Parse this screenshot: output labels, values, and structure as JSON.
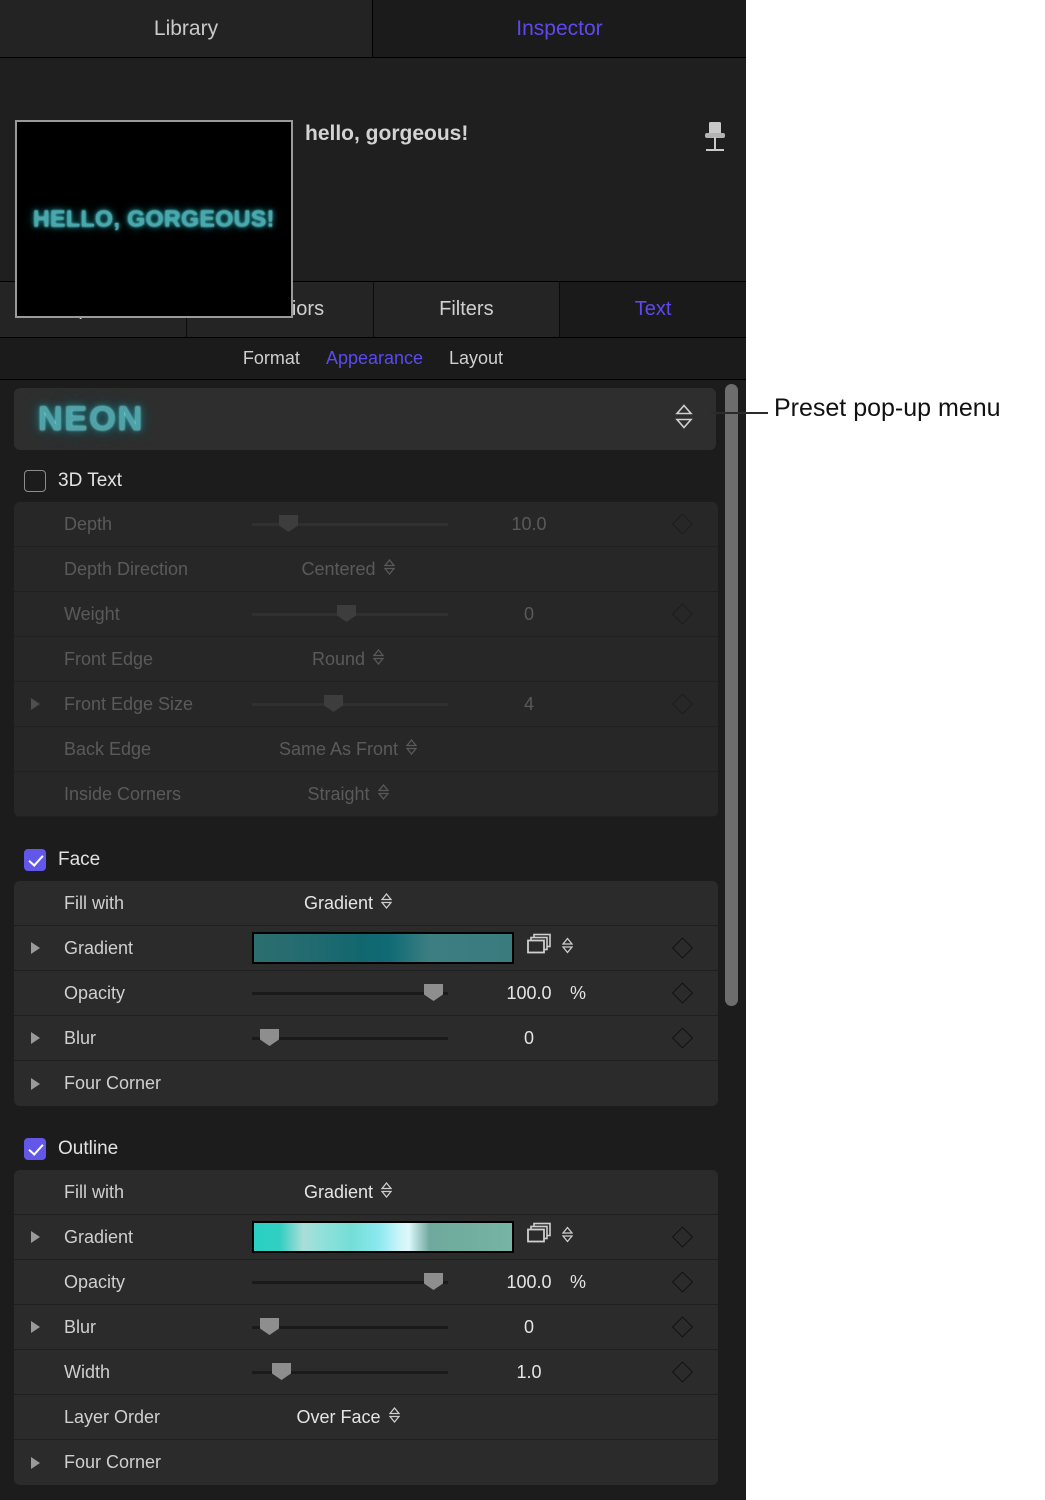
{
  "top_tabs": [
    {
      "label": "Library",
      "active": false
    },
    {
      "label": "Inspector",
      "active": true
    }
  ],
  "preview": {
    "object_title": "hello, gorgeous!",
    "thumbnail_text": "HELLO, GORGEOUS!",
    "pin_icon": "pin-icon"
  },
  "category_tabs": [
    {
      "label": "Properties",
      "active": false
    },
    {
      "label": "Behaviors",
      "active": false
    },
    {
      "label": "Filters",
      "active": false
    },
    {
      "label": "Text",
      "active": true
    }
  ],
  "sub_tabs": [
    {
      "label": "Format",
      "active": false
    },
    {
      "label": "Appearance",
      "active": true
    },
    {
      "label": "Layout",
      "active": false
    }
  ],
  "preset": {
    "name": "NEON",
    "stepper_icon": "stepper-updown-icon"
  },
  "sections": {
    "three_d_text": {
      "title": "3D Text",
      "checked": false,
      "enabled": false,
      "rows": [
        {
          "label": "Depth",
          "type": "slider",
          "value": "10.0",
          "unit": "",
          "knob": 0.17,
          "disclose": false,
          "keyframe": true
        },
        {
          "label": "Depth Direction",
          "type": "popup",
          "value": "Centered",
          "disclose": false,
          "keyframe": false
        },
        {
          "label": "Weight",
          "type": "slider",
          "value": "0",
          "unit": "",
          "knob": 0.48,
          "disclose": false,
          "keyframe": true
        },
        {
          "label": "Front Edge",
          "type": "popup",
          "value": "Round",
          "disclose": false,
          "keyframe": false
        },
        {
          "label": "Front Edge Size",
          "type": "slider",
          "value": "4",
          "unit": "",
          "knob": 0.41,
          "disclose": true,
          "keyframe": true
        },
        {
          "label": "Back Edge",
          "type": "popup",
          "value": "Same As Front",
          "disclose": false,
          "keyframe": false
        },
        {
          "label": "Inside Corners",
          "type": "popup",
          "value": "Straight",
          "disclose": false,
          "keyframe": false
        }
      ]
    },
    "face": {
      "title": "Face",
      "checked": true,
      "enabled": true,
      "rows": [
        {
          "label": "Fill with",
          "type": "popup",
          "value": "Gradient",
          "disclose": false,
          "keyframe": false
        },
        {
          "label": "Gradient",
          "type": "gradient",
          "gradient": "face",
          "disclose": true,
          "keyframe": true
        },
        {
          "label": "Opacity",
          "type": "slider",
          "value": "100.0",
          "unit": "%",
          "knob": 0.92,
          "disclose": false,
          "keyframe": true
        },
        {
          "label": "Blur",
          "type": "slider",
          "value": "0",
          "unit": "",
          "knob": 0.04,
          "disclose": true,
          "keyframe": true
        },
        {
          "label": "Four Corner",
          "type": "plain",
          "disclose": true,
          "keyframe": false
        }
      ]
    },
    "outline": {
      "title": "Outline",
      "checked": true,
      "enabled": true,
      "rows": [
        {
          "label": "Fill with",
          "type": "popup",
          "value": "Gradient",
          "disclose": false,
          "keyframe": false
        },
        {
          "label": "Gradient",
          "type": "gradient",
          "gradient": "outline",
          "disclose": true,
          "keyframe": true
        },
        {
          "label": "Opacity",
          "type": "slider",
          "value": "100.0",
          "unit": "%",
          "knob": 0.92,
          "disclose": false,
          "keyframe": true
        },
        {
          "label": "Blur",
          "type": "slider",
          "value": "0",
          "unit": "",
          "knob": 0.04,
          "disclose": true,
          "keyframe": true
        },
        {
          "label": "Width",
          "type": "slider",
          "value": "1.0",
          "unit": "",
          "knob": 0.1,
          "disclose": false,
          "keyframe": true
        },
        {
          "label": "Layer Order",
          "type": "popup",
          "value": "Over Face",
          "disclose": false,
          "keyframe": false
        },
        {
          "label": "Four Corner",
          "type": "plain",
          "disclose": true,
          "keyframe": false
        }
      ]
    }
  },
  "callout": {
    "text": "Preset pop-up menu"
  },
  "colors": {
    "accent": "#5b4af0",
    "checkbox": "#6257e8",
    "panel_bg": "#1c1c1c",
    "row_bg": "#2b2b2b",
    "neon_teal": "#4fa3a8",
    "face_gradient": [
      "#2d6e6f",
      "#17676f",
      "#0d6a76",
      "#3b7d81",
      "#3a7a7d"
    ],
    "outline_gradient": [
      "#2ad0c2",
      "#a9ded9",
      "#7fe0da",
      "#b9f0f7",
      "#d8f7fb",
      "#6ba99f",
      "#74b3a6"
    ]
  }
}
